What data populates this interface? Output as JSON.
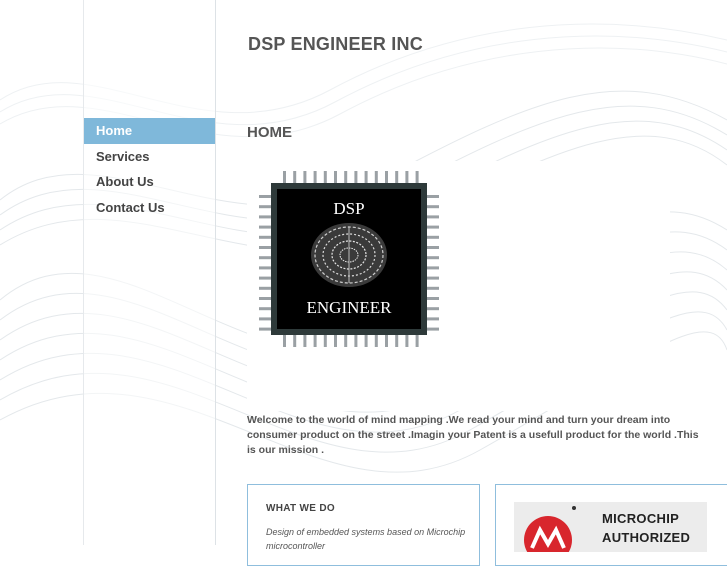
{
  "site": {
    "title": "DSP ENGINEER INC"
  },
  "nav": {
    "items": [
      {
        "label": "Home",
        "active": true
      },
      {
        "label": "Services",
        "active": false
      },
      {
        "label": "About Us",
        "active": false
      },
      {
        "label": "Contact Us",
        "active": false
      }
    ]
  },
  "main": {
    "heading": "HOME",
    "logo": {
      "top_text": "DSP",
      "bottom_text": "ENGINEER"
    },
    "welcome": "Welcome to the world of mind mapping .We read your mind and turn your dream into consumer product on the street .Imagin your Patent is a usefull product for the world .This is our mission ."
  },
  "what_we_do": {
    "title": "WHAT WE DO",
    "text": "Design of embedded systems based on Microchip microcontroller"
  },
  "microchip_badge": {
    "line1": "MICROCHIP",
    "line2": "AUTHORIZED"
  },
  "colors": {
    "nav_active": "#7fb8da",
    "box_border": "#8fbedd",
    "text": "#555555"
  }
}
